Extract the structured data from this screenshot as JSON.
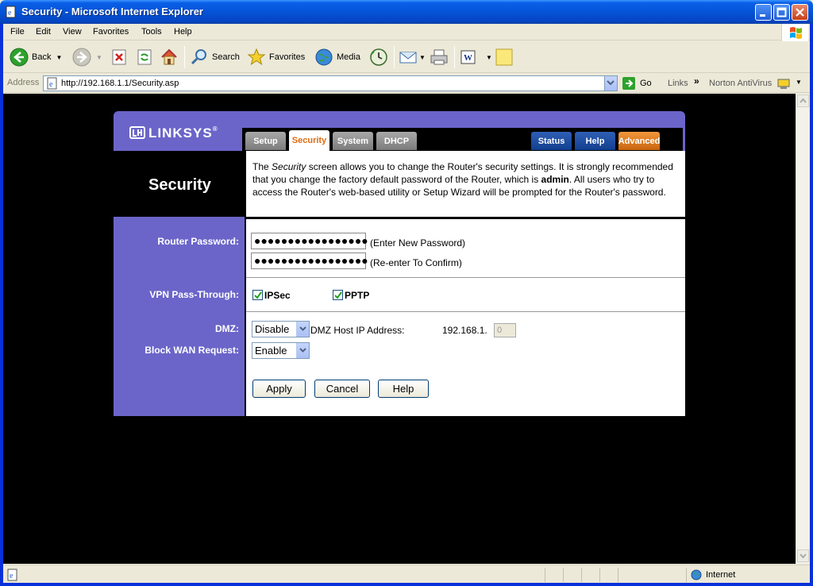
{
  "window": {
    "title": "Security - Microsoft Internet Explorer"
  },
  "menu": [
    "File",
    "Edit",
    "View",
    "Favorites",
    "Tools",
    "Help"
  ],
  "toolbar": {
    "back_label": "Back",
    "search_label": "Search",
    "favorites_label": "Favorites",
    "media_label": "Media"
  },
  "address": {
    "label": "Address",
    "url": "http://192.168.1.1/Security.asp",
    "go_label": "Go",
    "links_label": "Links",
    "norton_label": "Norton AntiVirus"
  },
  "router": {
    "logo": "LINKSYS",
    "logo_mark": "®",
    "tabs": {
      "setup": "Setup",
      "security": "Security",
      "system": "System",
      "dhcp": "DHCP",
      "status": "Status",
      "help": "Help",
      "advanced": "Advanced"
    },
    "page_title": "Security",
    "description": {
      "part1": "The ",
      "italic": "Security",
      "part2": " screen allows you to change the Router's security settings. It is strongly recommended that you change the factory default password of the Router, which is ",
      "bold": "admin",
      "part3": ". All users who try to access the Router's web-based utility or Setup Wizard will be prompted for the Router's password."
    },
    "password": {
      "label": "Router Password:",
      "value1": "●●●●●●●●●●●●●●●●●",
      "hint1": "(Enter New Password)",
      "value2": "●●●●●●●●●●●●●●●●●",
      "hint2": "(Re-enter To Confirm)"
    },
    "vpn": {
      "label": "VPN Pass-Through:",
      "ipsec_label": "IPSec",
      "ipsec_checked": true,
      "pptp_label": "PPTP",
      "pptp_checked": true
    },
    "dmz": {
      "label": "DMZ:",
      "value": "Disable",
      "host_label": "DMZ Host IP Address:",
      "ip_prefix": "192.168.1.",
      "ip_last": "0"
    },
    "block_wan": {
      "label": "Block WAN Request:",
      "value": "Enable"
    },
    "buttons": {
      "apply": "Apply",
      "cancel": "Cancel",
      "help": "Help"
    }
  },
  "status": {
    "zone": "Internet"
  },
  "colors": {
    "linksys_purple": "#6b65c9",
    "active_tab_text": "#e06a10",
    "xp_blue": "#0553d6"
  }
}
